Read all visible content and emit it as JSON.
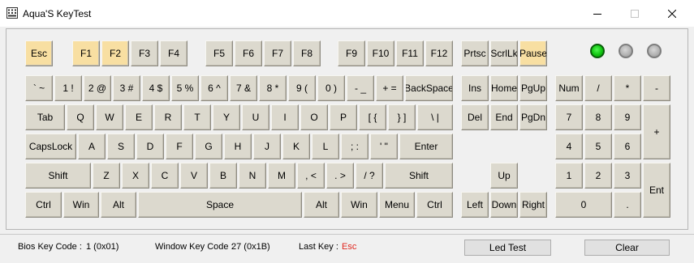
{
  "window": {
    "title": "Aqua'S KeyTest",
    "minimize_icon": "minimize-icon",
    "maximize_icon": "maximize-icon",
    "close_icon": "close-icon"
  },
  "colors": {
    "pressed_key": "#f8dfa2",
    "key_face": "#dcd9ce",
    "led_on": "#11c611",
    "led_off": "#b0b0b0",
    "last_key_value": "#e0261e"
  },
  "keyboard": {
    "function_row": [
      "Esc",
      "F1",
      "F2",
      "F3",
      "F4",
      "F5",
      "F6",
      "F7",
      "F8",
      "F9",
      "F10",
      "F11",
      "F12",
      "Prtsc",
      "ScrlLk",
      "Pause"
    ],
    "pressed_keys": [
      "Esc",
      "F1",
      "F2",
      "Pause"
    ],
    "number_row": [
      "` ~",
      "1 !",
      "2 @",
      "3 #",
      "4 $",
      "5 %",
      "6 ^",
      "7 &",
      "8 *",
      "9 (",
      "0 )",
      "- _",
      "+ =",
      "BackSpace"
    ],
    "top_row": [
      "Tab",
      "Q",
      "W",
      "E",
      "R",
      "T",
      "Y",
      "U",
      "I",
      "O",
      "P",
      "[ {",
      "} ]",
      "\\ |"
    ],
    "home_row": [
      "CapsLock",
      "A",
      "S",
      "D",
      "F",
      "G",
      "H",
      "J",
      "K",
      "L",
      "; :",
      "' \"",
      "Enter"
    ],
    "shift_row": [
      "Shift",
      "Z",
      "X",
      "C",
      "V",
      "B",
      "N",
      "M",
      ", <",
      ". >",
      "/ ?",
      "Shift"
    ],
    "bottom_row": [
      "Ctrl",
      "Win",
      "Alt",
      "Space",
      "Alt",
      "Win",
      "Menu",
      "Ctrl"
    ],
    "nav_cluster": [
      "Ins",
      "Home",
      "PgUp",
      "Del",
      "End",
      "PgDn"
    ],
    "arrows": [
      "Up",
      "Left",
      "Down",
      "Right"
    ],
    "numpad": [
      "Num",
      "/",
      "*",
      "-",
      "7",
      "8",
      "9",
      "+",
      "4",
      "5",
      "6",
      "1",
      "2",
      "3",
      "Ent",
      "0",
      "."
    ],
    "leds": [
      {
        "name": "num-lock",
        "on": true
      },
      {
        "name": "caps-lock",
        "on": false
      },
      {
        "name": "scroll-lock",
        "on": false
      }
    ]
  },
  "status": {
    "bios_label": "Bios Key Code :",
    "bios_value": "1 (0x01)",
    "window_label": "Window Key Code :",
    "window_value": "27 (0x1B)",
    "last_label": "Last Key :",
    "last_value": "Esc"
  },
  "buttons": {
    "led_test": "Led Test",
    "clear": "Clear"
  }
}
